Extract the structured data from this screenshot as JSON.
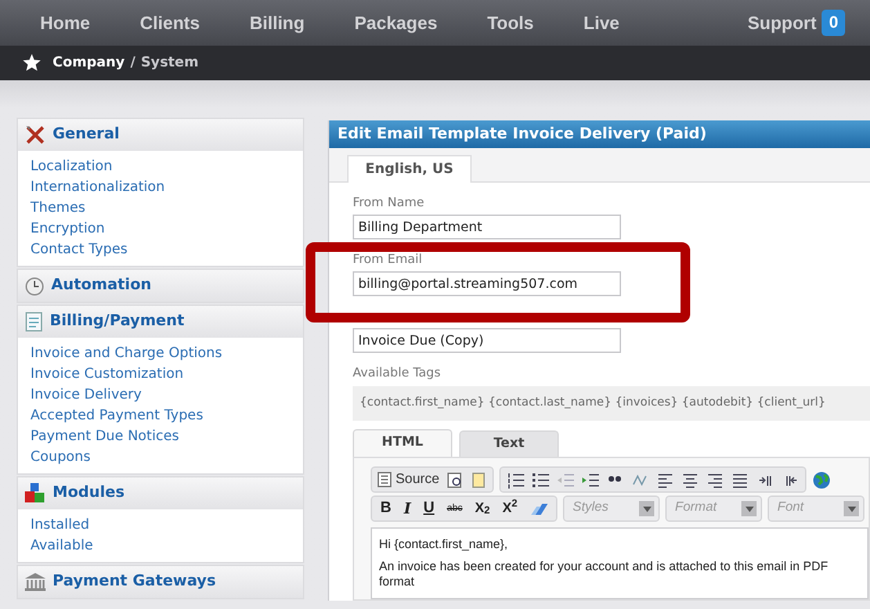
{
  "nav": {
    "items": [
      {
        "label": "Home"
      },
      {
        "label": "Clients"
      },
      {
        "label": "Billing"
      },
      {
        "label": "Packages"
      },
      {
        "label": "Tools"
      },
      {
        "label": "Live"
      }
    ],
    "support": {
      "label": "Support",
      "badge": "0"
    }
  },
  "breadcrumb": {
    "first": "Company",
    "separator": "/",
    "second": "System"
  },
  "sidebar": {
    "sections": [
      {
        "title": "General",
        "items": [
          "Localization",
          "Internationalization",
          "Themes",
          "Encryption",
          "Contact Types"
        ]
      },
      {
        "title": "Automation"
      },
      {
        "title": "Billing/Payment",
        "items": [
          "Invoice and Charge Options",
          "Invoice Customization",
          "Invoice Delivery",
          "Accepted Payment Types",
          "Payment Due Notices",
          "Coupons"
        ]
      },
      {
        "title": "Modules",
        "items": [
          "Installed",
          "Available"
        ]
      },
      {
        "title": "Payment Gateways"
      }
    ]
  },
  "panel": {
    "title": "Edit Email Template Invoice Delivery (Paid)",
    "language_tab": "English, US",
    "fields": [
      {
        "label": "From Name",
        "value": "Billing Department",
        "highlighted": false
      },
      {
        "label": "From Email",
        "value": "billing@portal.streaming507.com",
        "highlighted": true
      },
      {
        "value": "Invoice Due (Copy)",
        "highlighted": false
      }
    ],
    "tags_label": "Available Tags",
    "tags": "{contact.first_name} {contact.last_name} {invoices} {autodebit} {client_url}",
    "editor_tabs": [
      {
        "label": "HTML",
        "selected": true
      },
      {
        "label": "Text",
        "selected": false
      }
    ],
    "toolbar": {
      "source": "Source",
      "format_buttons": [
        "B",
        "I",
        "U",
        "abc",
        "X$_{2}$",
        "X$^{2}$"
      ],
      "combos": [
        {
          "placeholder": "Styles"
        },
        {
          "placeholder": "Format"
        },
        {
          "placeholder": "Font"
        }
      ]
    },
    "body": [
      "Hi {contact.first_name},",
      "An invoice has been created for your account and is attached to this email in PDF format"
    ]
  }
}
